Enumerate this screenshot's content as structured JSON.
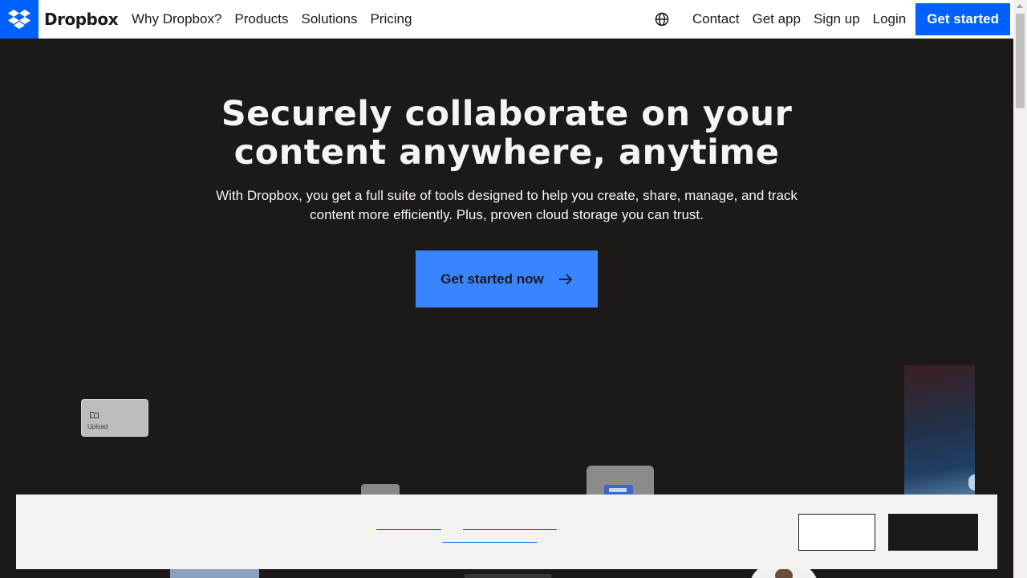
{
  "brand": {
    "name": "Dropbox",
    "icon": "dropbox-logo-icon",
    "color": "#0061fe"
  },
  "nav": {
    "links": [
      "Why Dropbox?",
      "Products",
      "Solutions",
      "Pricing"
    ],
    "right_links": [
      "Contact",
      "Get app",
      "Sign up",
      "Login"
    ],
    "globe_icon": "globe-icon",
    "cta_label": "Get started"
  },
  "hero": {
    "title_line1": "Securely collaborate on your",
    "title_line2": "content anywhere, anytime",
    "subtitle_line1": "With Dropbox, you get a full suite of tools designed to help you create, share, manage, and track",
    "subtitle_line2": "content more efficiently. Plus, proven cloud storage you can trust.",
    "cta_label": "Get started now",
    "cta_icon": "arrow-right-icon",
    "cta_color": "#3984ff"
  },
  "cards": {
    "upload_label": "Upload",
    "upload_icon": "folder-upload-icon"
  },
  "colors": {
    "background": "#1e1919",
    "cookie_banner": "#f5f3ef",
    "text_light": "#f7f5f2"
  }
}
